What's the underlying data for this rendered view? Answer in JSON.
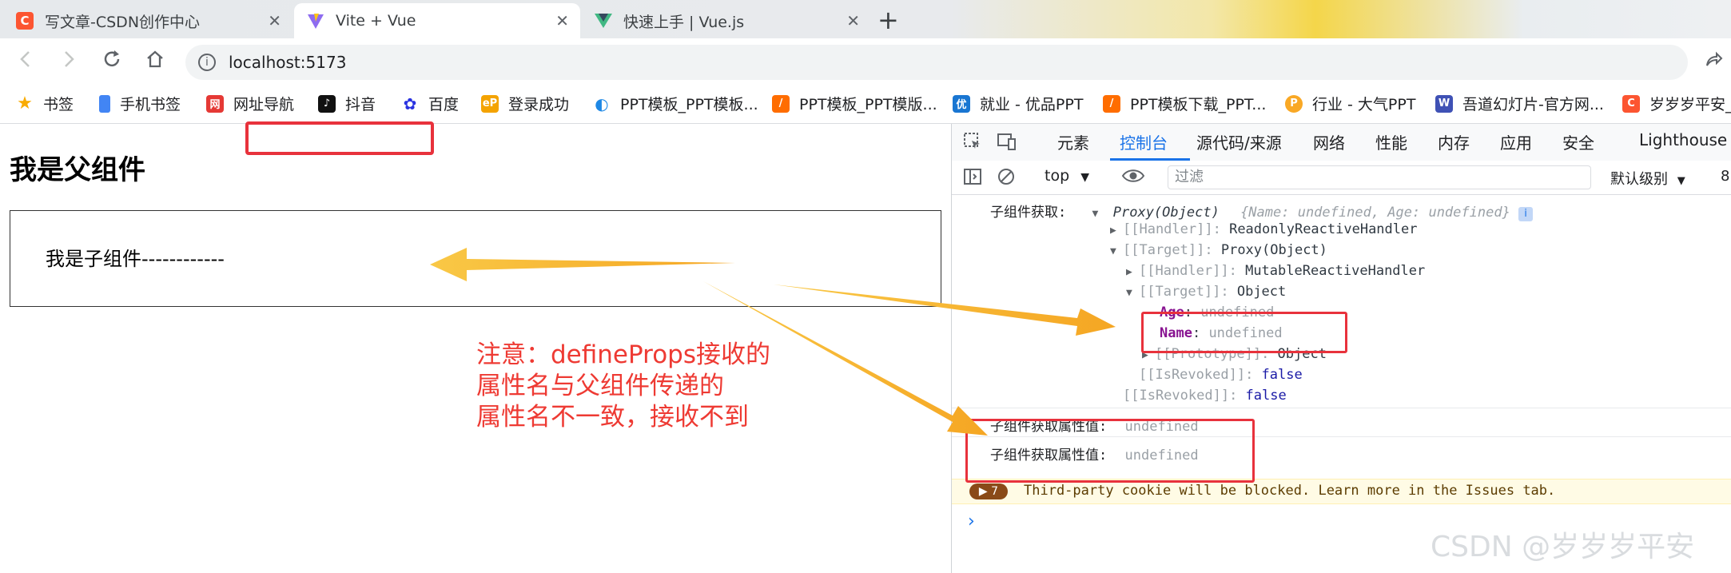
{
  "browser": {
    "tabs": [
      {
        "title": "写文章-CSDN创作中心",
        "icon": "csdn-icon",
        "active": false
      },
      {
        "title": "Vite + Vue",
        "icon": "vite-icon",
        "active": true
      },
      {
        "title": "快速上手 | Vue.js",
        "icon": "vue-icon",
        "active": false
      }
    ],
    "close_glyph": "✕",
    "new_tab_glyph": "+",
    "url": "localhost:5173",
    "bookmarks": [
      {
        "label": "书签",
        "icon": "star-icon",
        "color": "#f9ab00"
      },
      {
        "label": "手机书签",
        "icon": "phone-icon",
        "color": "#4285f4"
      },
      {
        "label": "网址导航",
        "icon": "nav-icon",
        "color": "#e53935"
      },
      {
        "label": "抖音",
        "icon": "douyin-icon",
        "color": "#111111"
      },
      {
        "label": "百度",
        "icon": "baidu-icon",
        "color": "#2932e1"
      },
      {
        "label": "登录成功",
        "icon": "ep-icon",
        "color": "#f4a300"
      },
      {
        "label": "PPT模板_PPT模板...",
        "icon": "ppt-icon",
        "color": "#1e88e5"
      },
      {
        "label": "PPT模板_PPT模版...",
        "icon": "ppt2-icon",
        "color": "#ff6d00"
      },
      {
        "label": "就业 - 优品PPT",
        "icon": "youpin-icon",
        "color": "#1976d2"
      },
      {
        "label": "PPT模板下载_PPT...",
        "icon": "ppt3-icon",
        "color": "#ff6d00"
      },
      {
        "label": "行业 - 大气PPT",
        "icon": "daqi-icon",
        "color": "#f9a825"
      },
      {
        "label": "吾道幻灯片-官方网...",
        "icon": "wudao-icon",
        "color": "#3f51b5"
      },
      {
        "label": "岁岁岁平安_...",
        "icon": "csdn-icon",
        "color": "#fc5531"
      }
    ]
  },
  "page": {
    "parent_title": "我是父组件",
    "child_text": "我是子组件------------",
    "note_lines": [
      "注意：defineProps接收的",
      "属性名与父组件传递的",
      "属性名不一致，接收不到"
    ]
  },
  "devtools": {
    "tabs": [
      "元素",
      "控制台",
      "源代码/来源",
      "网络",
      "性能",
      "内存",
      "应用",
      "安全",
      "Lighthouse"
    ],
    "active_tab": "控制台",
    "context": "top",
    "filter_placeholder": "过滤",
    "level": "默认级别",
    "issues_count": "8",
    "console": {
      "log1_label": "子组件获取:",
      "log1_summary_type": "Proxy(Object)",
      "log1_summary_preview": "{Name: undefined, Age: undefined}",
      "handler1_key": "[[Handler]]",
      "handler1_val": "ReadonlyReactiveHandler",
      "target1_key": "[[Target]]",
      "target1_val": "Proxy(Object)",
      "handler2_key": "[[Handler]]",
      "handler2_val": "MutableReactiveHandler",
      "target2_key": "[[Target]]",
      "target2_val": "Object",
      "prop_age_key": "Age",
      "prop_age_val": "undefined",
      "prop_name_key": "Name",
      "prop_name_val": "undefined",
      "proto_key": "[[Prototype]]",
      "proto_val": "Object",
      "revoked_inner_key": "[[IsRevoked]]",
      "revoked_inner_val": "false",
      "revoked_outer_key": "[[IsRevoked]]",
      "revoked_outer_val": "false",
      "log2_label": "子组件获取属性值:",
      "log2_val": "undefined",
      "log3_label": "子组件获取属性值:",
      "log3_val": "undefined",
      "warning_count": "7",
      "warning_text": "Third-party cookie will be blocked. Learn more in the Issues tab."
    }
  },
  "watermark": "CSDN @岁岁岁平安",
  "colors": {
    "accent": "#1a73e8",
    "annotation_red": "#e8323c",
    "arrow_yellow": "#f7b731",
    "note_red": "#ee3a33"
  }
}
